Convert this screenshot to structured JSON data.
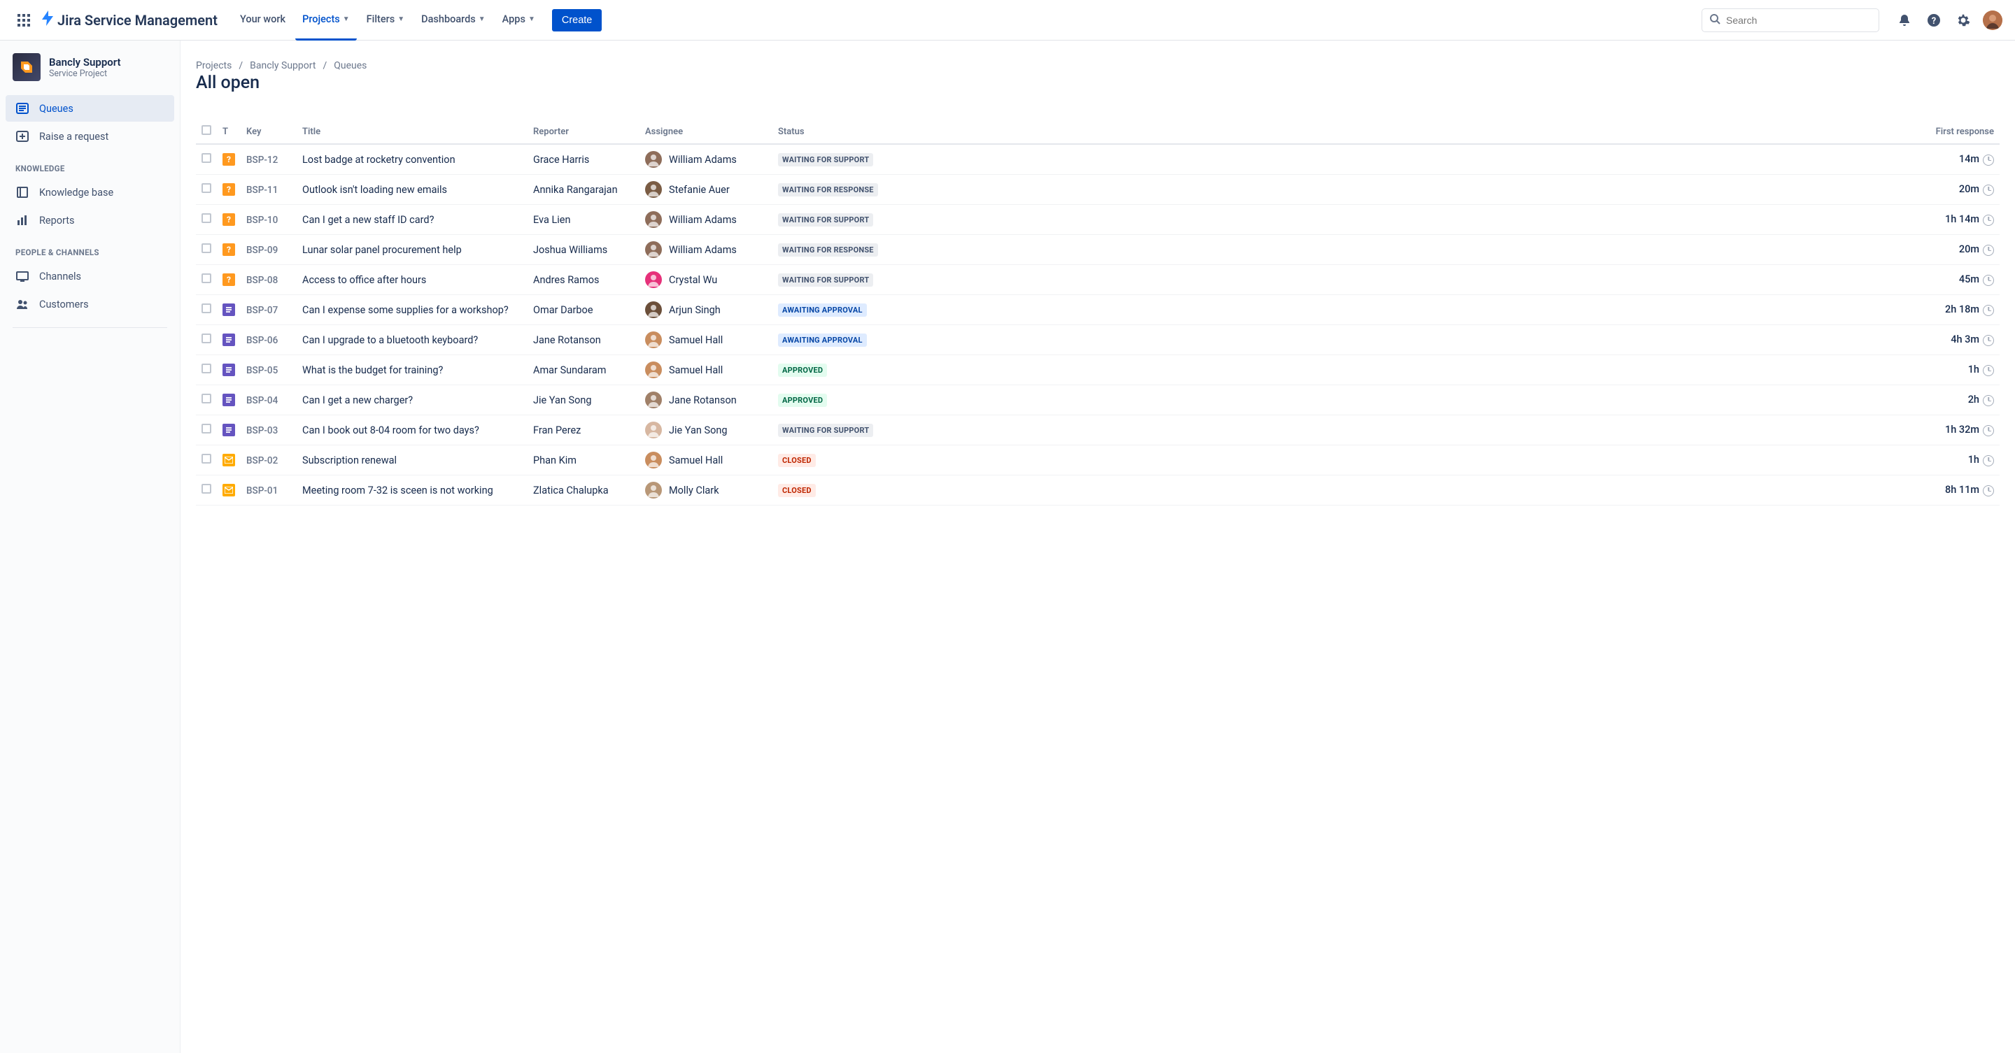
{
  "topbar": {
    "product_name": "Jira Service Management",
    "nav": {
      "your_work": "Your work",
      "projects": "Projects",
      "filters": "Filters",
      "dashboards": "Dashboards",
      "apps": "Apps"
    },
    "create": "Create",
    "search_placeholder": "Search"
  },
  "sidebar": {
    "project_name": "Bancly Support",
    "project_type": "Service Project",
    "queues": "Queues",
    "raise_request": "Raise a request",
    "heading_knowledge": "KNOWLEDGE",
    "knowledge_base": "Knowledge base",
    "reports": "Reports",
    "heading_people": "PEOPLE & CHANNELS",
    "channels": "Channels",
    "customers": "Customers"
  },
  "crumbs": {
    "projects": "Projects",
    "project": "Bancly Support",
    "queues": "Queues"
  },
  "page_title": "All open",
  "table": {
    "headers": {
      "type": "T",
      "key": "Key",
      "title": "Title",
      "reporter": "Reporter",
      "assignee": "Assignee",
      "status": "Status",
      "first_response": "First response"
    },
    "statuses": {
      "waiting_support": "WAITING FOR SUPPORT",
      "waiting_response": "WAITING FOR RESPONSE",
      "awaiting_approval": "AWAITING APPROVAL",
      "approved": "APPROVED",
      "closed": "CLOSED"
    },
    "rows": [
      {
        "type": "question",
        "key": "BSP-12",
        "title": "Lost badge at rocketry convention",
        "reporter": "Grace Harris",
        "assignee": "William Adams",
        "status": "waiting_support",
        "status_style": "default",
        "response": "14m",
        "avatar": "#8e6d5a"
      },
      {
        "type": "question",
        "key": "BSP-11",
        "title": "Outlook isn't loading new emails",
        "reporter": "Annika Rangarajan",
        "assignee": "Stefanie Auer",
        "status": "waiting_response",
        "status_style": "default",
        "response": "20m",
        "avatar": "#7a5c44"
      },
      {
        "type": "question",
        "key": "BSP-10",
        "title": "Can I get a new staff ID card?",
        "reporter": "Eva Lien",
        "assignee": "William Adams",
        "status": "waiting_support",
        "status_style": "default",
        "response": "1h 14m",
        "avatar": "#8e6d5a"
      },
      {
        "type": "question",
        "key": "BSP-09",
        "title": "Lunar solar panel procurement help",
        "reporter": "Joshua Williams",
        "assignee": "William Adams",
        "status": "waiting_response",
        "status_style": "default",
        "response": "20m",
        "avatar": "#8e6d5a"
      },
      {
        "type": "question",
        "key": "BSP-08",
        "title": "Access to office after hours",
        "reporter": "Andres Ramos",
        "assignee": "Crystal Wu",
        "status": "waiting_support",
        "status_style": "default",
        "response": "45m",
        "avatar": "#e6317a"
      },
      {
        "type": "task",
        "key": "BSP-07",
        "title": "Can I expense some supplies for a workshop?",
        "reporter": "Omar Darboe",
        "assignee": "Arjun Singh",
        "status": "awaiting_approval",
        "status_style": "blue",
        "response": "2h 18m",
        "avatar": "#6b4f3a"
      },
      {
        "type": "task",
        "key": "BSP-06",
        "title": "Can I upgrade to a bluetooth keyboard?",
        "reporter": "Jane Rotanson",
        "assignee": "Samuel Hall",
        "status": "awaiting_approval",
        "status_style": "blue",
        "response": "4h 3m",
        "avatar": "#c98d5e"
      },
      {
        "type": "task",
        "key": "BSP-05",
        "title": "What is the budget for training?",
        "reporter": "Amar Sundaram",
        "assignee": "Samuel Hall",
        "status": "approved",
        "status_style": "green",
        "response": "1h",
        "avatar": "#c98d5e"
      },
      {
        "type": "task",
        "key": "BSP-04",
        "title": "Can I get a new charger?",
        "reporter": "Jie Yan Song",
        "assignee": "Jane Rotanson",
        "status": "approved",
        "status_style": "green",
        "response": "2h",
        "avatar": "#a08068"
      },
      {
        "type": "task",
        "key": "BSP-03",
        "title": "Can I book out 8-04 room for two days?",
        "reporter": "Fran Perez",
        "assignee": "Jie Yan Song",
        "status": "waiting_support",
        "status_style": "default",
        "response": "1h 32m",
        "avatar": "#d7b7a1"
      },
      {
        "type": "mail",
        "key": "BSP-02",
        "title": "Subscription renewal",
        "reporter": "Phan Kim",
        "assignee": "Samuel Hall",
        "status": "closed",
        "status_style": "red",
        "response": "1h",
        "avatar": "#c98d5e"
      },
      {
        "type": "mail",
        "key": "BSP-01",
        "title": "Meeting room 7-32 is sceen is not working",
        "reporter": "Zlatica Chalupka",
        "assignee": "Molly Clark",
        "status": "closed",
        "status_style": "red",
        "response": "8h 11m",
        "avatar": "#b89777"
      }
    ]
  }
}
